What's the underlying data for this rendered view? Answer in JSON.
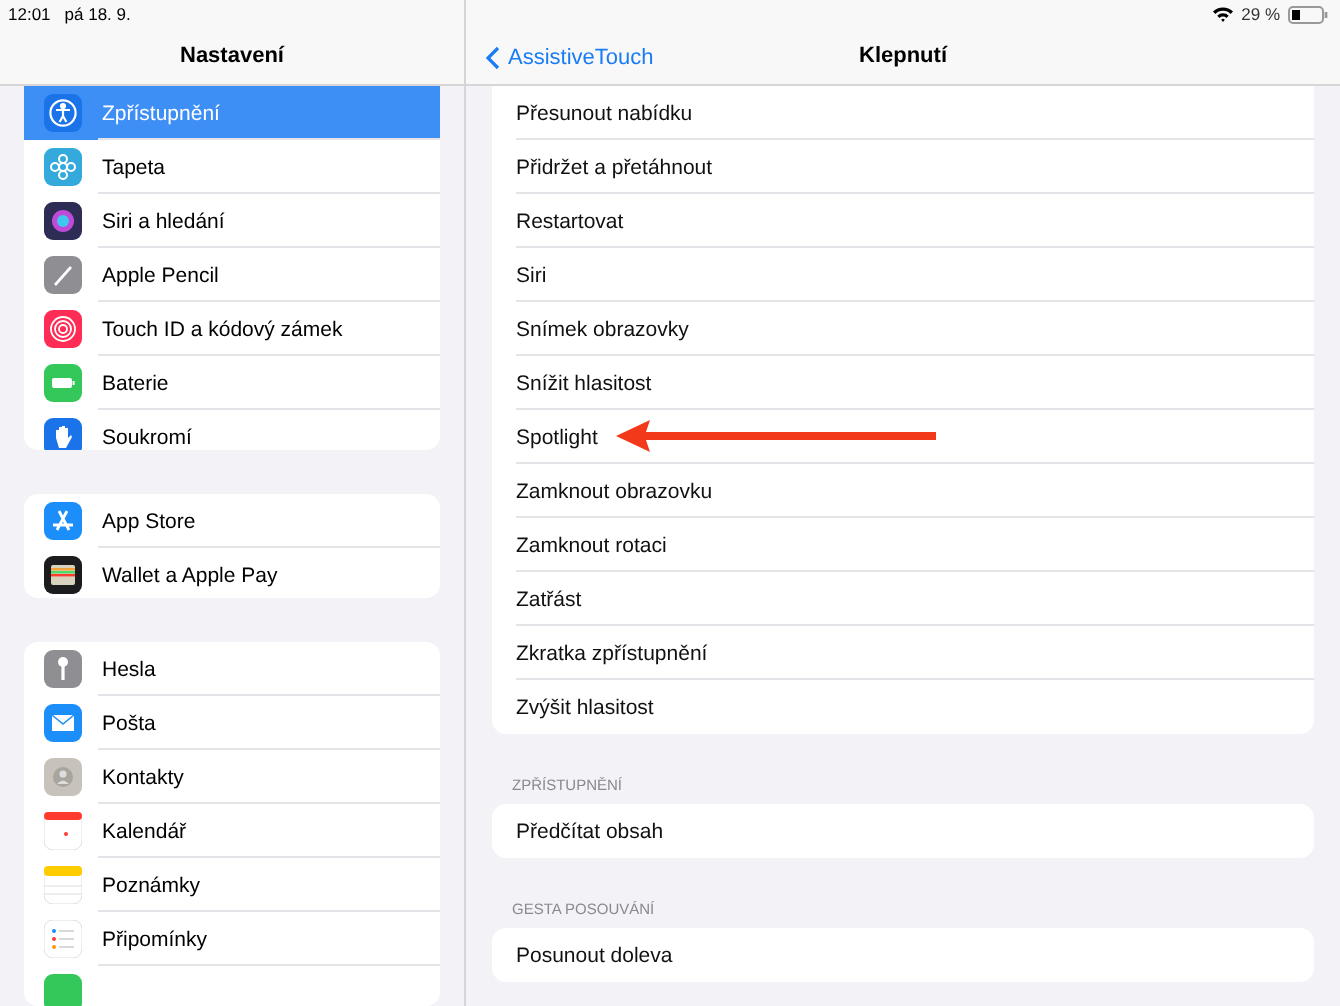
{
  "status_bar": {
    "time": "12:01",
    "date": "pá 18. 9.",
    "battery": "29 %"
  },
  "sidebar": {
    "title": "Nastavení",
    "groups": [
      {
        "items": [
          {
            "label": "Zpřístupnění",
            "kind": "accessibility",
            "color": "#1a73e8",
            "selected": true
          },
          {
            "label": "Tapeta",
            "kind": "flower",
            "color": "#34aadc",
            "selected": false
          },
          {
            "label": "Siri a hledání",
            "kind": "siri",
            "color": "#2c2c54",
            "selected": false
          },
          {
            "label": "Apple Pencil",
            "kind": "pencil",
            "color": "#8e8e93",
            "selected": false
          },
          {
            "label": "Touch ID a kódový zámek",
            "kind": "fingerprint",
            "color": "#ff2d55",
            "selected": false
          },
          {
            "label": "Baterie",
            "kind": "battery",
            "color": "#34c759",
            "selected": false
          },
          {
            "label": "Soukromí",
            "kind": "hand",
            "color": "#1a73e8",
            "selected": false
          }
        ]
      },
      {
        "items": [
          {
            "label": "App Store",
            "kind": "appstore",
            "color": "#1c8ef9",
            "selected": false
          },
          {
            "label": "Wallet a Apple Pay",
            "kind": "wallet",
            "color": "#1c1c1e",
            "selected": false
          }
        ]
      },
      {
        "items": [
          {
            "label": "Hesla",
            "kind": "key",
            "color": "#8e8e93",
            "selected": false
          },
          {
            "label": "Pošta",
            "kind": "mail",
            "color": "#1c8ef9",
            "selected": false
          },
          {
            "label": "Kontakty",
            "kind": "contact",
            "color": "#c7c2bb",
            "selected": false
          },
          {
            "label": "Kalendář",
            "kind": "calendar",
            "selected": false
          },
          {
            "label": "Poznámky",
            "kind": "notes",
            "selected": false
          },
          {
            "label": "Připomínky",
            "kind": "reminders",
            "selected": false
          },
          {
            "kind": "plain",
            "color": "#34c759",
            "selected": false
          }
        ]
      }
    ]
  },
  "detail": {
    "back": "AssistiveTouch",
    "title": "Klepnutí",
    "sections": [
      {
        "rows": [
          {
            "label": "Přesunout nabídku",
            "arrow": false
          },
          {
            "label": "Přidržet a přetáhnout",
            "arrow": false
          },
          {
            "label": "Restartovat",
            "arrow": false
          },
          {
            "label": "Siri",
            "arrow": false
          },
          {
            "label": "Snímek obrazovky",
            "arrow": false
          },
          {
            "label": "Snížit hlasitost",
            "arrow": false
          },
          {
            "label": "Spotlight",
            "arrow": true
          },
          {
            "label": "Zamknout obrazovku",
            "arrow": false
          },
          {
            "label": "Zamknout rotaci",
            "arrow": false
          },
          {
            "label": "Zatřást",
            "arrow": false
          },
          {
            "label": "Zkratka zpřístupnění",
            "arrow": false
          },
          {
            "label": "Zvýšit hlasitost",
            "arrow": false
          }
        ]
      },
      {
        "header": "ZPŘÍSTUPNĚNÍ",
        "rows": [
          {
            "label": "Předčítat obsah",
            "arrow": false
          }
        ]
      },
      {
        "header": "GESTA POSOUVÁNÍ",
        "rows": [
          {
            "label": "Posunout doleva",
            "arrow": false
          }
        ]
      }
    ]
  }
}
